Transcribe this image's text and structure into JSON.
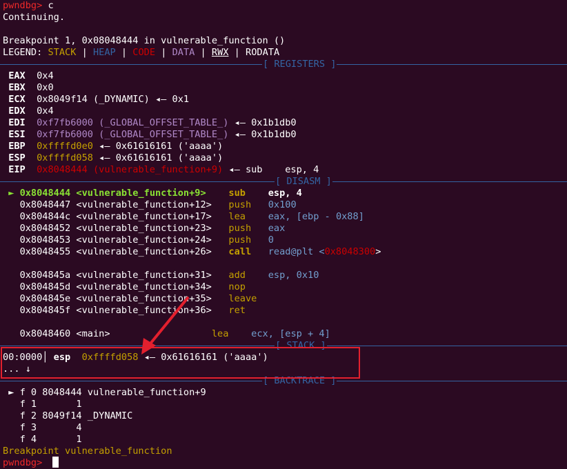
{
  "prompt_line": {
    "prompt": "pwndbg>",
    "cmd": " c"
  },
  "continuing": "Continuing.",
  "breakpoint_msg": "Breakpoint 1, 0x08048444 in vulnerable_function ()",
  "legend": {
    "label": "LEGEND:",
    "stack": "STACK",
    "heap": "HEAP",
    "code": "CODE",
    "data": "DATA",
    "rwx": "RWX",
    "rodata": "RODATA",
    "sep": " | "
  },
  "sections": {
    "registers": "[ REGISTERS ]",
    "disasm": "[ DISASM ]",
    "stack": "[ STACK ]",
    "backtrace": "[ BACKTRACE ]"
  },
  "registers": [
    {
      "name": "EAX",
      "value": "0x4",
      "rest": ""
    },
    {
      "name": "EBX",
      "value": "0x0",
      "rest": ""
    },
    {
      "name": "ECX",
      "value": "0x8049f14 (_DYNAMIC)",
      "rest": " ◂— 0x1"
    },
    {
      "name": "EDX",
      "value": "0x4",
      "rest": ""
    },
    {
      "name": "EDI",
      "value": "0xf7fb6000 (_GLOBAL_OFFSET_TABLE_)",
      "rest": " ◂— 0x1b1db0"
    },
    {
      "name": "ESI",
      "value": "0xf7fb6000 (_GLOBAL_OFFSET_TABLE_)",
      "rest": " ◂— 0x1b1db0"
    },
    {
      "name": "EBP",
      "value": "0xffffd0e0",
      "rest": " ◂— 0x61616161 ('aaaa')"
    },
    {
      "name": "ESP",
      "value": "0xffffd058",
      "rest": " ◂— 0x61616161 ('aaaa')"
    },
    {
      "name": "EIP",
      "value": "0x8048444 (vulnerable_function+9)",
      "rest": " ◂— sub    esp, 4"
    }
  ],
  "disasm": [
    {
      "marker": "►",
      "addr": "0x8048444",
      "sym": "<vulnerable_function+9>",
      "mnem": "sub",
      "ops": "esp, 4"
    },
    {
      "addr": "0x8048447",
      "sym": "<vulnerable_function+12>",
      "mnem": "push",
      "ops": "0x100"
    },
    {
      "addr": "0x804844c",
      "sym": "<vulnerable_function+17>",
      "mnem": "lea",
      "ops_a": "eax, [ebp - ",
      "ops_b": "0x88",
      "ops_c": "]"
    },
    {
      "addr": "0x8048452",
      "sym": "<vulnerable_function+23>",
      "mnem": "push",
      "ops": "eax"
    },
    {
      "addr": "0x8048453",
      "sym": "<vulnerable_function+24>",
      "mnem": "push",
      "ops": "0"
    },
    {
      "addr": "0x8048455",
      "sym": "<vulnerable_function+26>",
      "mnem": "call",
      "ops_a": "read@plt <",
      "ops_b": "0x8048300",
      "ops_c": ">"
    },
    {
      "addr": "0x804845a",
      "sym": "<vulnerable_function+31>",
      "mnem": "add",
      "ops": "esp, 0x10"
    },
    {
      "addr": "0x804845d",
      "sym": "<vulnerable_function+34>",
      "mnem": "nop",
      "ops": ""
    },
    {
      "addr": "0x804845e",
      "sym": "<vulnerable_function+35>",
      "mnem": "leave",
      "ops": ""
    },
    {
      "addr": "0x804845f",
      "sym": "<vulnerable_function+36>",
      "mnem": "ret",
      "ops": ""
    },
    {
      "addr": "0x8048460",
      "sym": "<main>",
      "mnem": "lea",
      "ops": "ecx, [esp + 4]"
    }
  ],
  "stack": {
    "offset": "00:0000",
    "reg": "esp",
    "addr": "0xffffd058",
    "rest": " ◂— 0x61616161 ('aaaa')",
    "more": "... ↓"
  },
  "backtrace": [
    {
      "marker": "►",
      "frame": "f 0",
      "addr": " 8048444",
      "sym": "vulnerable_function+9"
    },
    {
      "frame": "f 1",
      "addr": "       1",
      "sym": ""
    },
    {
      "frame": "f 2",
      "addr": " 8049f14",
      "sym": "_DYNAMIC"
    },
    {
      "frame": "f 3",
      "addr": "       4",
      "sym": ""
    },
    {
      "frame": "f 4",
      "addr": "       1",
      "sym": ""
    }
  ],
  "footer": "Breakpoint vulnerable_function",
  "final_prompt": "pwndbg>"
}
